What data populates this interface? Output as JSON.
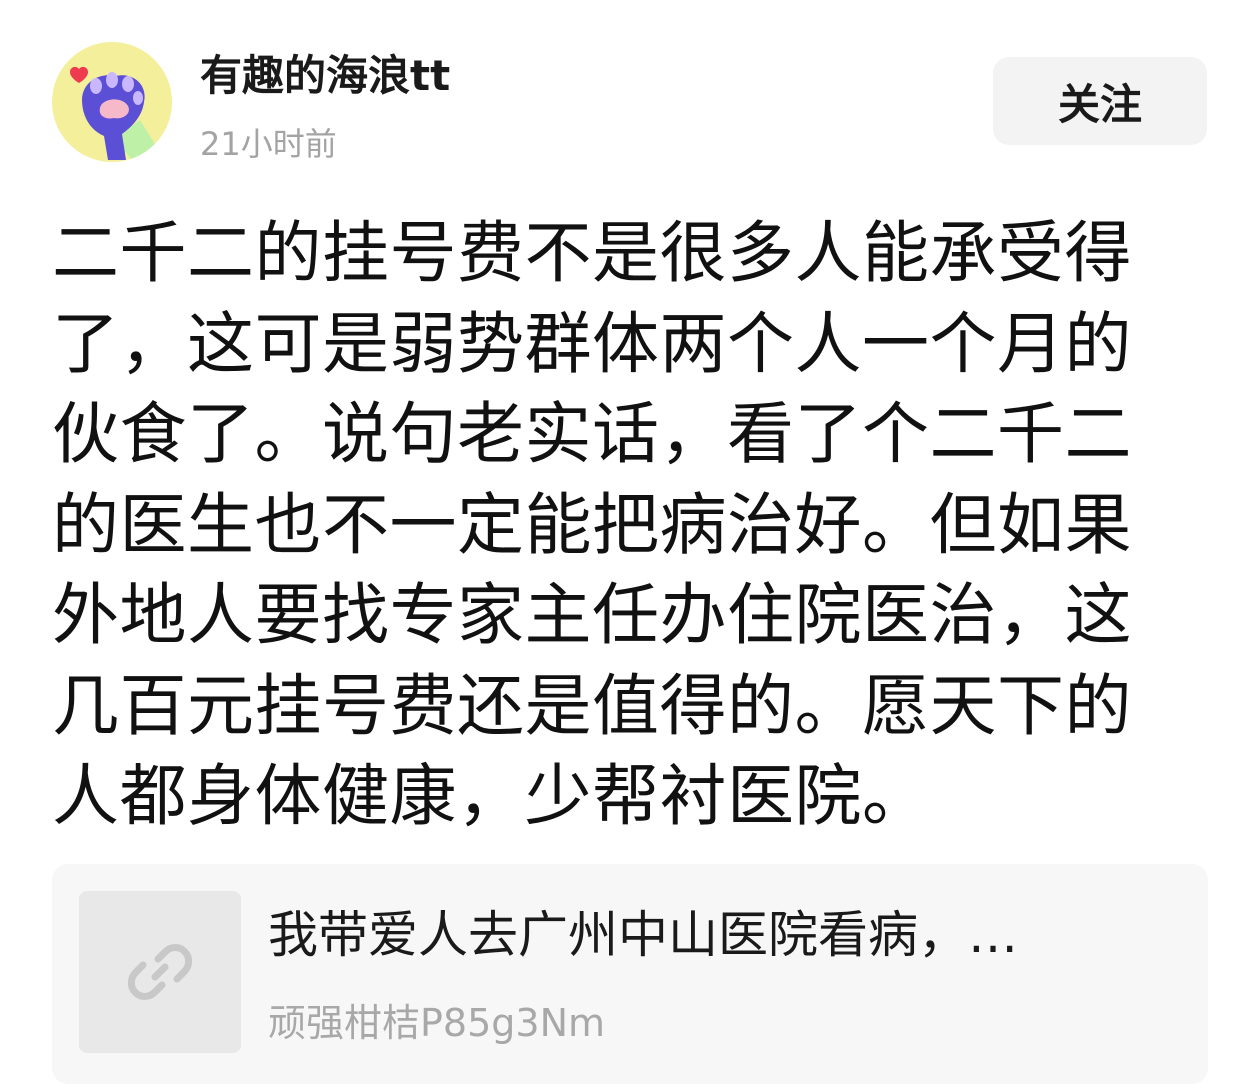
{
  "header": {
    "username": "有趣的海浪tt",
    "timestamp": "21小时前",
    "follow_label": "关注",
    "avatar_icon": "cat-paw-icon"
  },
  "post": {
    "lines": [
      "二千二的挂号费不是很多人能承受得",
      "了，这可是弱势群体两个人一个月的",
      "伙食了。说句老实话，看了个二千二",
      "的医生也不一定能把病治好。但如果",
      "外地人要找专家主任办住院医治，这",
      "几百元挂号费还是值得的。愿天下的",
      "人都身体健康，少帮衬医院。"
    ]
  },
  "link_card": {
    "title": "我带爱人去广州中山医院看病，…",
    "author": "顽强柑桔P85g3Nm",
    "icon": "link-icon"
  },
  "colors": {
    "avatar_bg": "#f3ef9a",
    "paw": "#5b4fd6",
    "heart": "#ee3b4f",
    "follow_bg": "#f3f3f3",
    "card_bg": "#f7f7f7",
    "muted_text": "#a3a3a3"
  }
}
